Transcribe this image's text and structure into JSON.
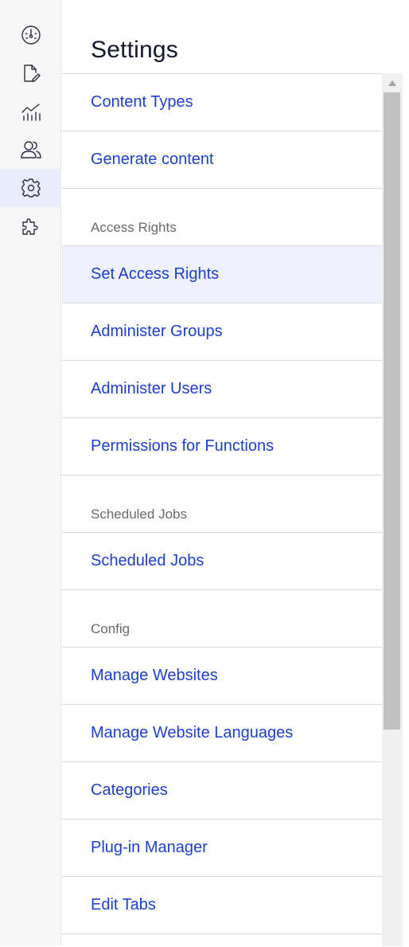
{
  "rail": {
    "items": [
      {
        "icon": "dashboard-icon",
        "active": false
      },
      {
        "icon": "edit-document-icon",
        "active": false
      },
      {
        "icon": "analytics-icon",
        "active": false
      },
      {
        "icon": "users-icon",
        "active": false
      },
      {
        "icon": "gear-icon",
        "active": true
      },
      {
        "icon": "puzzle-icon",
        "active": false
      }
    ]
  },
  "page": {
    "title": "Settings"
  },
  "list": {
    "items": [
      {
        "kind": "link",
        "label": "Content Types"
      },
      {
        "kind": "link",
        "label": "Generate content"
      },
      {
        "kind": "section",
        "label": "Access Rights"
      },
      {
        "kind": "link",
        "label": "Set Access Rights",
        "selected": true
      },
      {
        "kind": "link",
        "label": "Administer Groups"
      },
      {
        "kind": "link",
        "label": "Administer Users"
      },
      {
        "kind": "link",
        "label": "Permissions for Functions"
      },
      {
        "kind": "section",
        "label": "Scheduled Jobs"
      },
      {
        "kind": "link",
        "label": "Scheduled Jobs"
      },
      {
        "kind": "section",
        "label": "Config"
      },
      {
        "kind": "link",
        "label": "Manage Websites"
      },
      {
        "kind": "link",
        "label": "Manage Website Languages"
      },
      {
        "kind": "link",
        "label": "Categories"
      },
      {
        "kind": "link",
        "label": "Plug-in Manager"
      },
      {
        "kind": "link",
        "label": "Edit Tabs"
      }
    ]
  }
}
